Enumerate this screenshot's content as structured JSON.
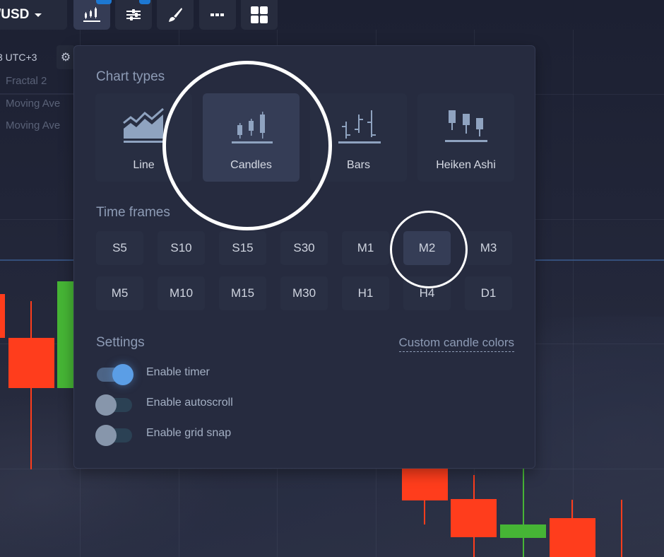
{
  "toolbar": {
    "pair_label": "/USD",
    "buttons": [
      {
        "name": "chart-type",
        "icon": "candles-icon",
        "active": true,
        "badge": true
      },
      {
        "name": "indicators",
        "icon": "sliders-icon",
        "active": false,
        "badge": true
      },
      {
        "name": "drawing",
        "icon": "brush-icon",
        "active": false,
        "badge": false
      },
      {
        "name": "line-style",
        "icon": "dash-icon",
        "active": false,
        "badge": false
      },
      {
        "name": "layout",
        "icon": "grid-icon",
        "active": false,
        "badge": false
      }
    ]
  },
  "chart_info": {
    "timezone": "3  UTC+3",
    "indicators": [
      "Fractal 2",
      "Moving Ave",
      "Moving Ave"
    ]
  },
  "panel": {
    "chart_types_title": "Chart types",
    "chart_types": [
      {
        "label": "Line",
        "icon": "line-chart-icon",
        "active": false
      },
      {
        "label": "Candles",
        "icon": "candles-icon",
        "active": true
      },
      {
        "label": "Bars",
        "icon": "bars-icon",
        "active": false
      },
      {
        "label": "Heiken Ashi",
        "icon": "heiken-ashi-icon",
        "active": false
      }
    ],
    "time_frames_title": "Time frames",
    "time_frames": [
      [
        "S5",
        "S10",
        "S15",
        "S30",
        "M1",
        "M2",
        "M3"
      ],
      [
        "M5",
        "M10",
        "M15",
        "M30",
        "H1",
        "H4",
        "D1"
      ]
    ],
    "selected_time_frame": "M2",
    "settings_title": "Settings",
    "custom_colors_link": "Custom candle colors",
    "settings": [
      {
        "label": "Enable timer",
        "on": true
      },
      {
        "label": "Enable autoscroll",
        "on": false
      },
      {
        "label": "Enable grid snap",
        "on": false
      }
    ]
  },
  "colors": {
    "bear": "#ff3d1c",
    "bull": "#46b535",
    "accent": "#5b9ee6",
    "badge": "#1d78d2"
  }
}
